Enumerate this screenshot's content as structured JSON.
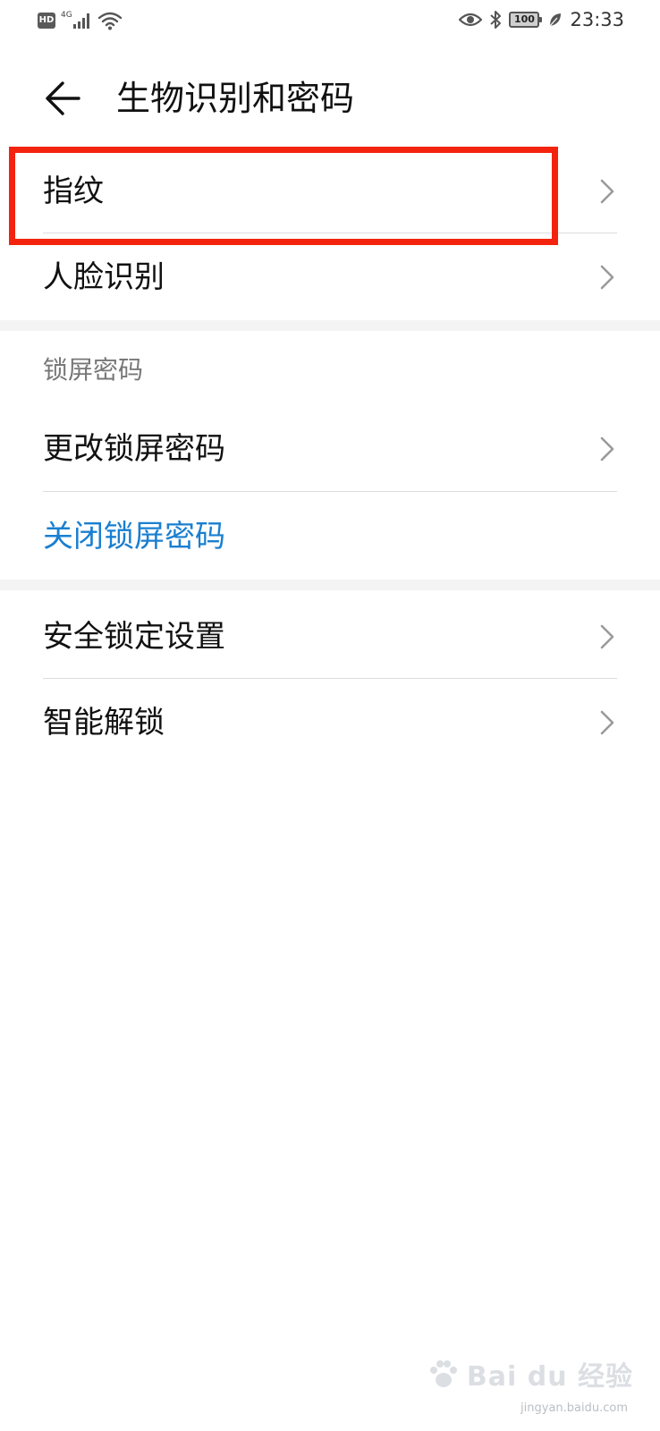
{
  "status_bar": {
    "left_badge": "HD",
    "network_type": "4G",
    "battery_level": "100",
    "time": "23:33",
    "icons": [
      "hd-icon",
      "signal-icon",
      "wifi-icon",
      "eye-icon",
      "bluetooth-icon",
      "battery-icon",
      "leaf-icon"
    ]
  },
  "header": {
    "title": "生物识别和密码",
    "back_icon": "back-arrow-icon"
  },
  "biometrics": {
    "items": [
      {
        "label": "指纹",
        "has_chevron": true
      },
      {
        "label": "人脸识别",
        "has_chevron": true
      }
    ]
  },
  "lock_screen": {
    "section_title": "锁屏密码",
    "items": [
      {
        "label": "更改锁屏密码",
        "has_chevron": true
      },
      {
        "label": "关闭锁屏密码",
        "has_chevron": false
      }
    ]
  },
  "security": {
    "items": [
      {
        "label": "安全锁定设置",
        "has_chevron": true
      },
      {
        "label": "智能解锁",
        "has_chevron": true
      }
    ]
  },
  "colors": {
    "accent_blue": "#1a7fd0",
    "highlight_red": "#f3230d",
    "divider": "#dcdcdc",
    "section_gap": "#f4f4f4"
  },
  "watermark": {
    "brand": "Bai du 经验",
    "url": "jingyan.baidu.com"
  }
}
